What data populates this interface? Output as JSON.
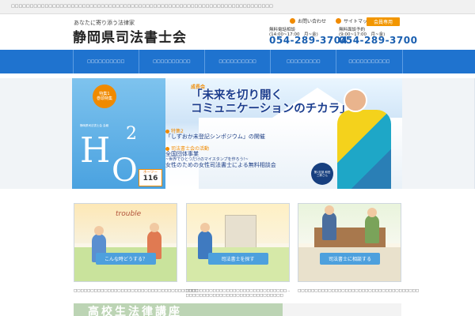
{
  "topbar": {
    "text": "□□□□□□□□□□□□□□□□□□□□□□□□□□□□□□□□□□□□□□□□□□□□□□□□□□□□□□□□□□□□□□□□□□□□□□"
  },
  "header": {
    "tagline": "あなたに寄り添う法律家",
    "site_name": "静岡県司法書士会",
    "utility": {
      "contact": "お問い合わせ",
      "sitemap": "サイトマップ",
      "members": "会員専用"
    },
    "tel1": {
      "label": "無料電話相談",
      "hours": "(14:00~17:00　月~金)",
      "number": "054-289-3704"
    },
    "tel2": {
      "label": "無料面談予約",
      "hours": "(9:00~17:00　月~金)",
      "number": "054-289-3700"
    }
  },
  "nav": {
    "items": [
      "□□□□□□□□□□",
      "□□□□□□□□□□",
      "□□□□□□□□□□",
      "□□□□□□□□□",
      "□□□□□□□□□□□"
    ]
  },
  "hero": {
    "tokushu_line1": "特集1",
    "tokushu_line2": "巻頭特集",
    "h2o_sub": "静岡県司法書士会 会報",
    "h": "H",
    "two": "2",
    "o": "O",
    "vol_label": "ホーツー",
    "vol_number": "116",
    "tag": "成長会",
    "title_line1": "「未来を切り開く",
    "title_line2": "コミュニケーションのチカラ」",
    "block1_kicker": "特集2",
    "block1_title": "「しずおか未登記シンポジウム」の開催",
    "block2_kicker": "司法書士会の活動",
    "block2_line1": "全国団体事業",
    "block2_line2": "~世界でひとつだけのマイスタンプを作ろう!~",
    "block2_line3": "女性のための女性司法書士による無料相談会",
    "badge": "第1支部 和田三郎さん"
  },
  "cards": [
    {
      "caption": "こんな時どうする？",
      "sign": "trouble",
      "desc": "□□□□□□□□□□□□□□□□□□□□□□□□□□□□□□□□□□□□□"
    },
    {
      "caption": "司法書士を探す",
      "desc": "□□□□□□□□□□□□□□□□□□□□□□□□□□□□□□...\n□□□□□□□□□□□□□□□□□□□□□□□□□□□□□"
    },
    {
      "caption": "司法書士に相談する",
      "desc": "□□□□□□□□□□□□□□□□□□□□□□□□□□□□□□□□□□□□"
    }
  ],
  "bottom": {
    "label": "高校生法律講座"
  },
  "colors": {
    "nav": "#1f73cf",
    "accent": "#f08a00",
    "phone": "#1a5fb0",
    "caption": "#4da0dd"
  }
}
